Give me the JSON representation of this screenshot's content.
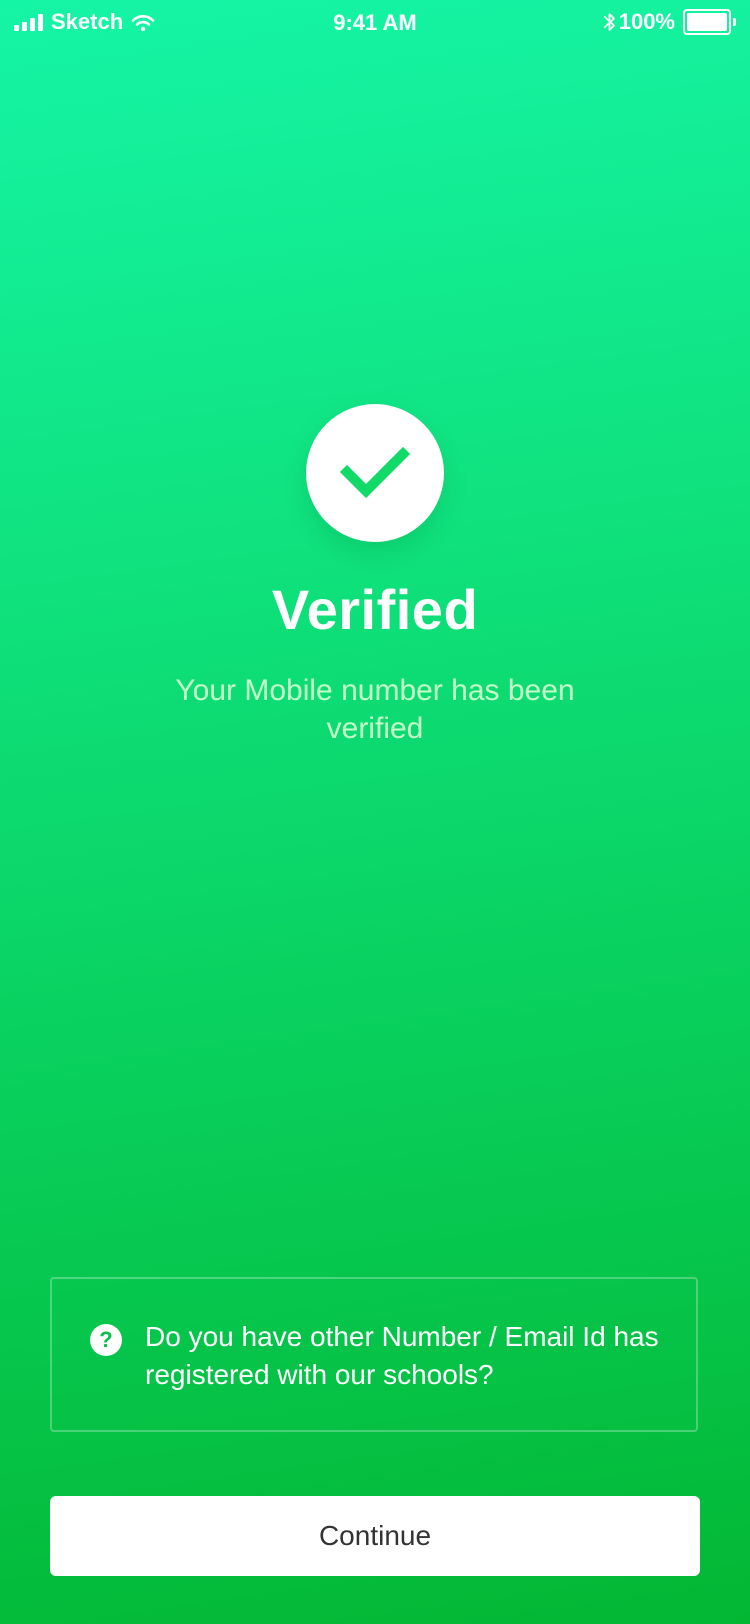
{
  "status_bar": {
    "carrier": "Sketch",
    "time": "9:41 AM",
    "battery_percent": "100%",
    "battery_level": 1.0,
    "icons": [
      "signal-icon",
      "wifi-icon",
      "bluetooth-icon",
      "battery-icon"
    ]
  },
  "verification": {
    "icon": "checkmark-icon",
    "title": "Verified",
    "subtitle": "Your Mobile number has been verified"
  },
  "info_box": {
    "icon": "question-icon",
    "icon_glyph": "?",
    "text": "Do you have other Number / Email Id has registered with our schools?"
  },
  "continue_button": {
    "label": "Continue"
  },
  "colors": {
    "gradient_top": "#15F5A6",
    "gradient_bottom": "#03B733",
    "check_color": "#12DA68",
    "subtitle_color": "#C4FFC8",
    "button_text": "#333333"
  }
}
